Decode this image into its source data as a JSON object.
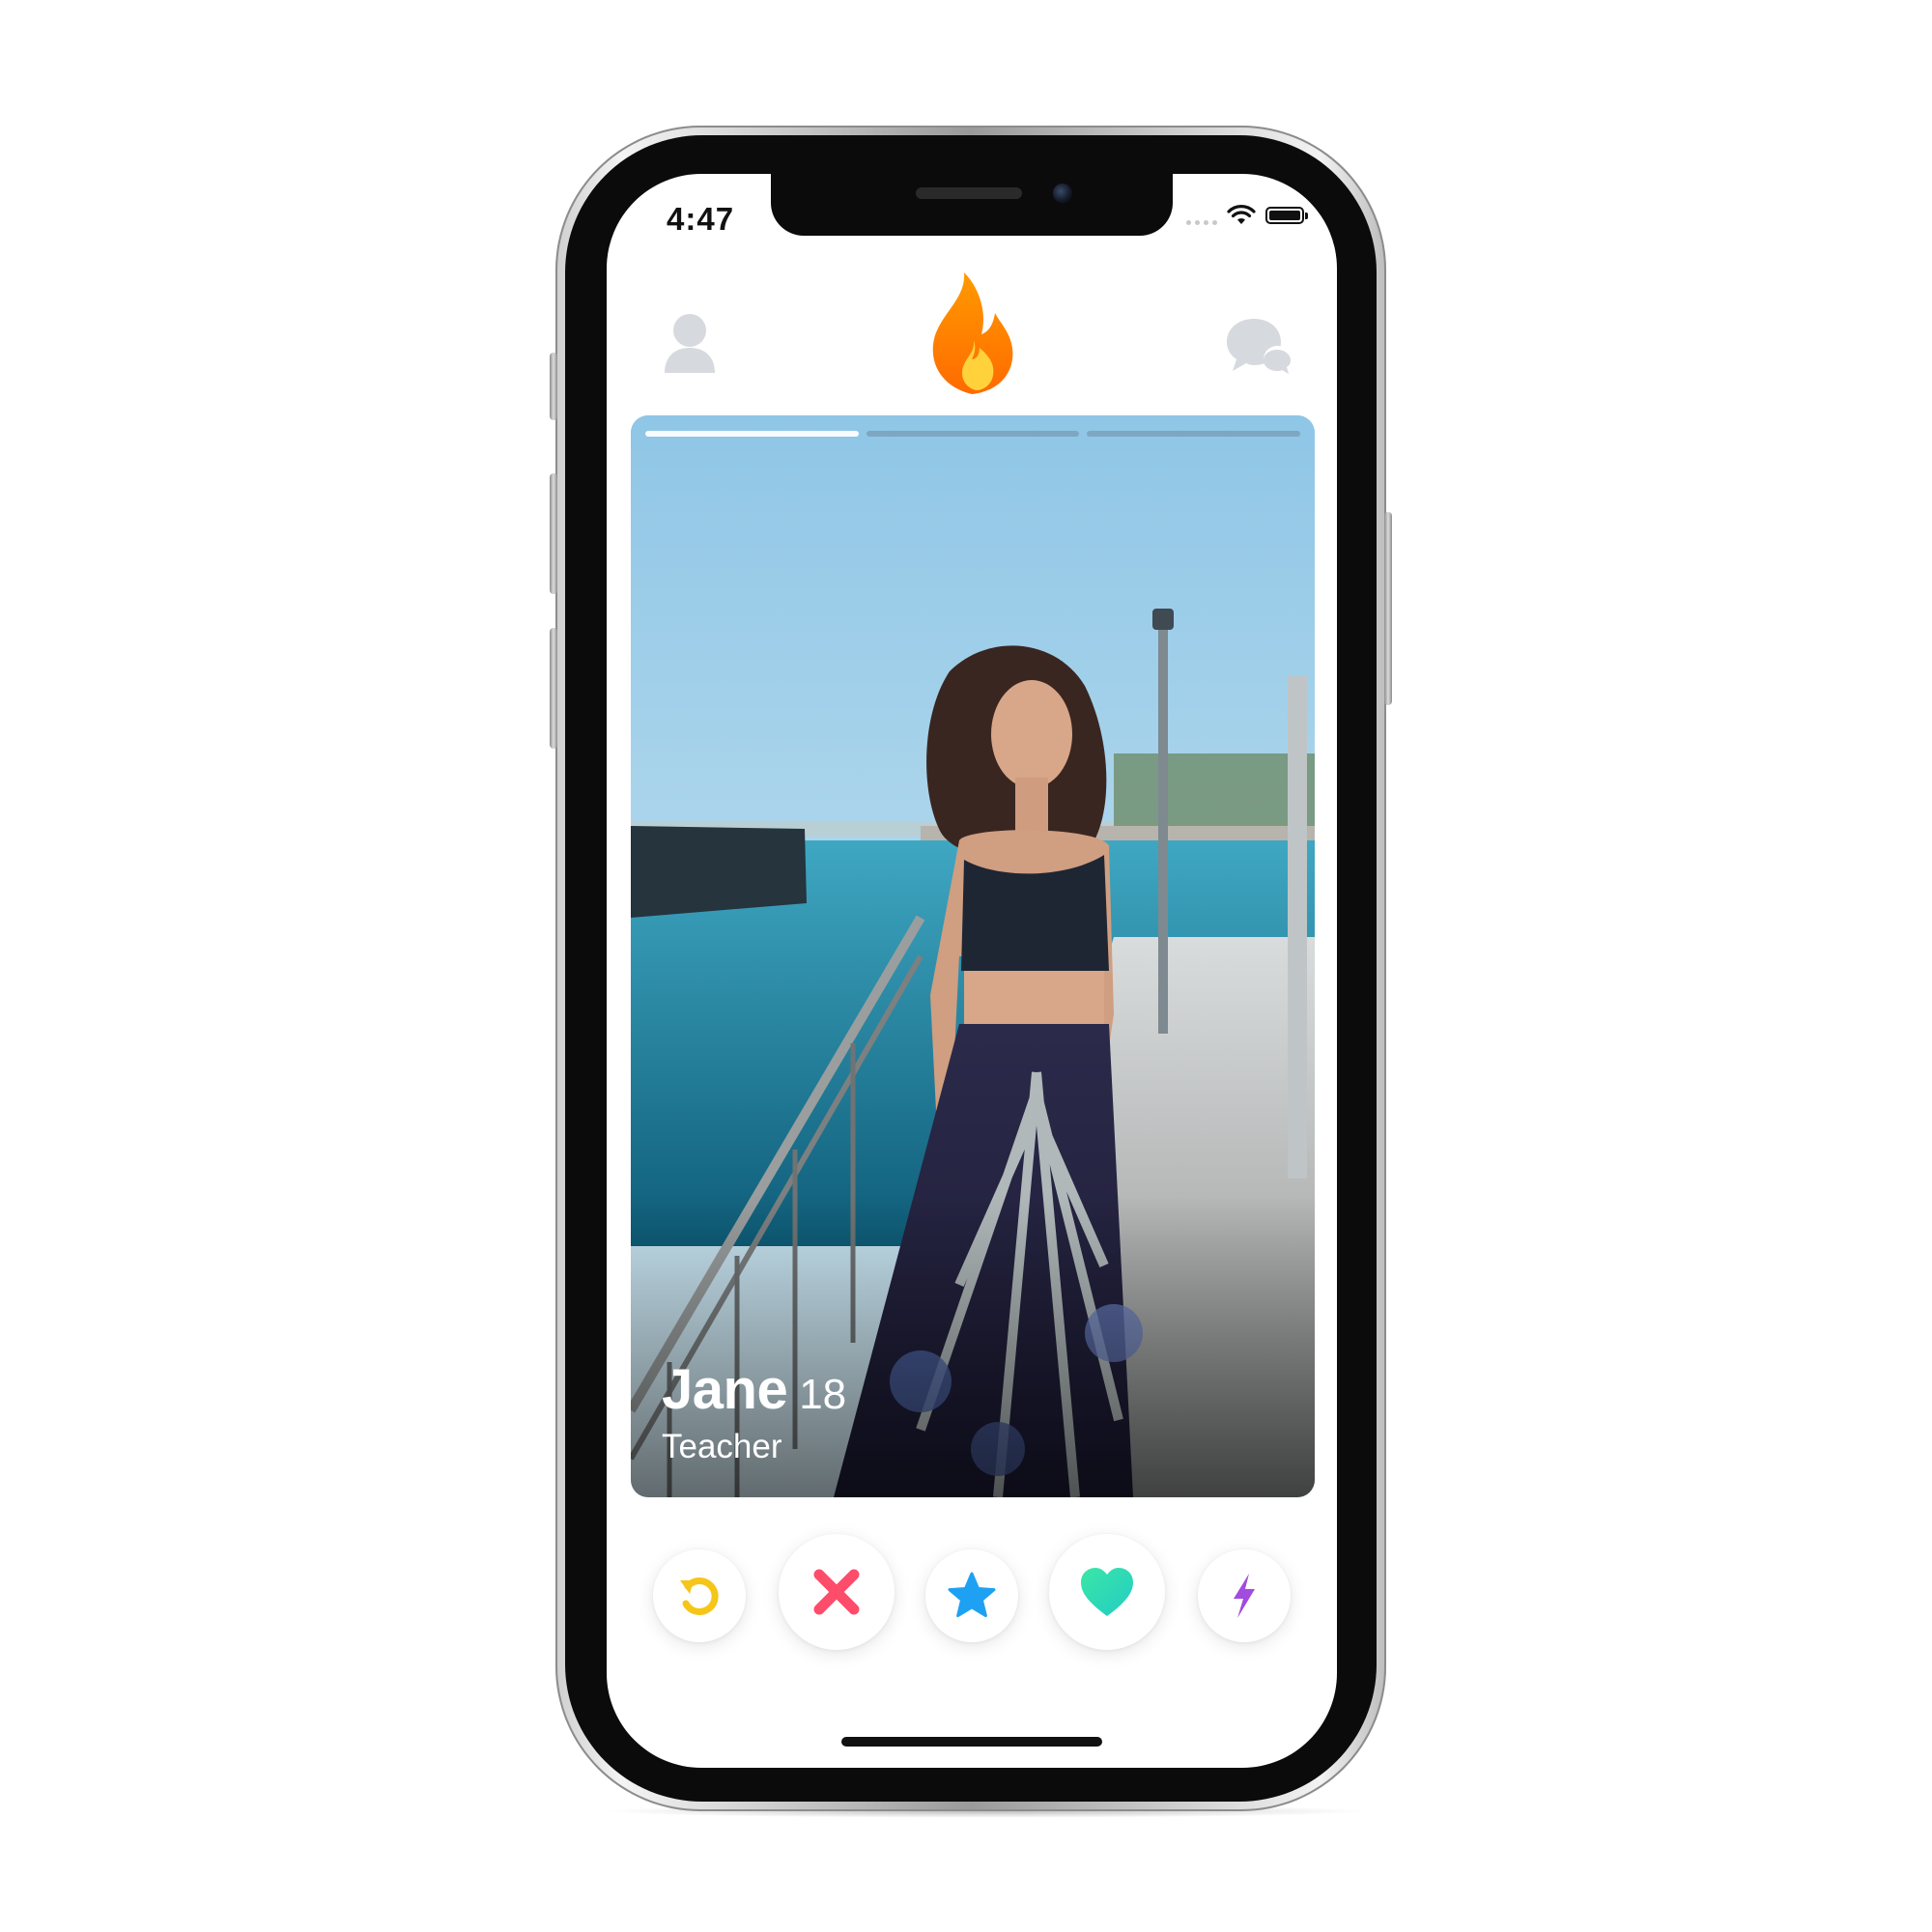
{
  "status_bar": {
    "time": "4:47"
  },
  "header": {
    "profile_icon": "profile-icon",
    "logo_icon": "flame-logo-icon",
    "messages_icon": "chat-bubbles-icon"
  },
  "card": {
    "name": "Jane",
    "age": "18",
    "job": "Teacher",
    "photo_pages_total": 3,
    "photo_page_active": 1
  },
  "actions": [
    {
      "name": "rewind",
      "icon": "rewind-icon",
      "color": "#F5C518"
    },
    {
      "name": "nope",
      "icon": "close-icon",
      "color": "#FE4C6B"
    },
    {
      "name": "super-like",
      "icon": "star-icon",
      "color": "#1EA1F2"
    },
    {
      "name": "like",
      "icon": "heart-icon",
      "color": "#2BD9B0"
    },
    {
      "name": "boost",
      "icon": "lightning-icon",
      "color": "#A24BDE"
    }
  ],
  "colors": {
    "flame_outer": "#FF8A00",
    "flame_inner": "#FFD23C",
    "header_icon_gray": "#D6D9DE"
  }
}
